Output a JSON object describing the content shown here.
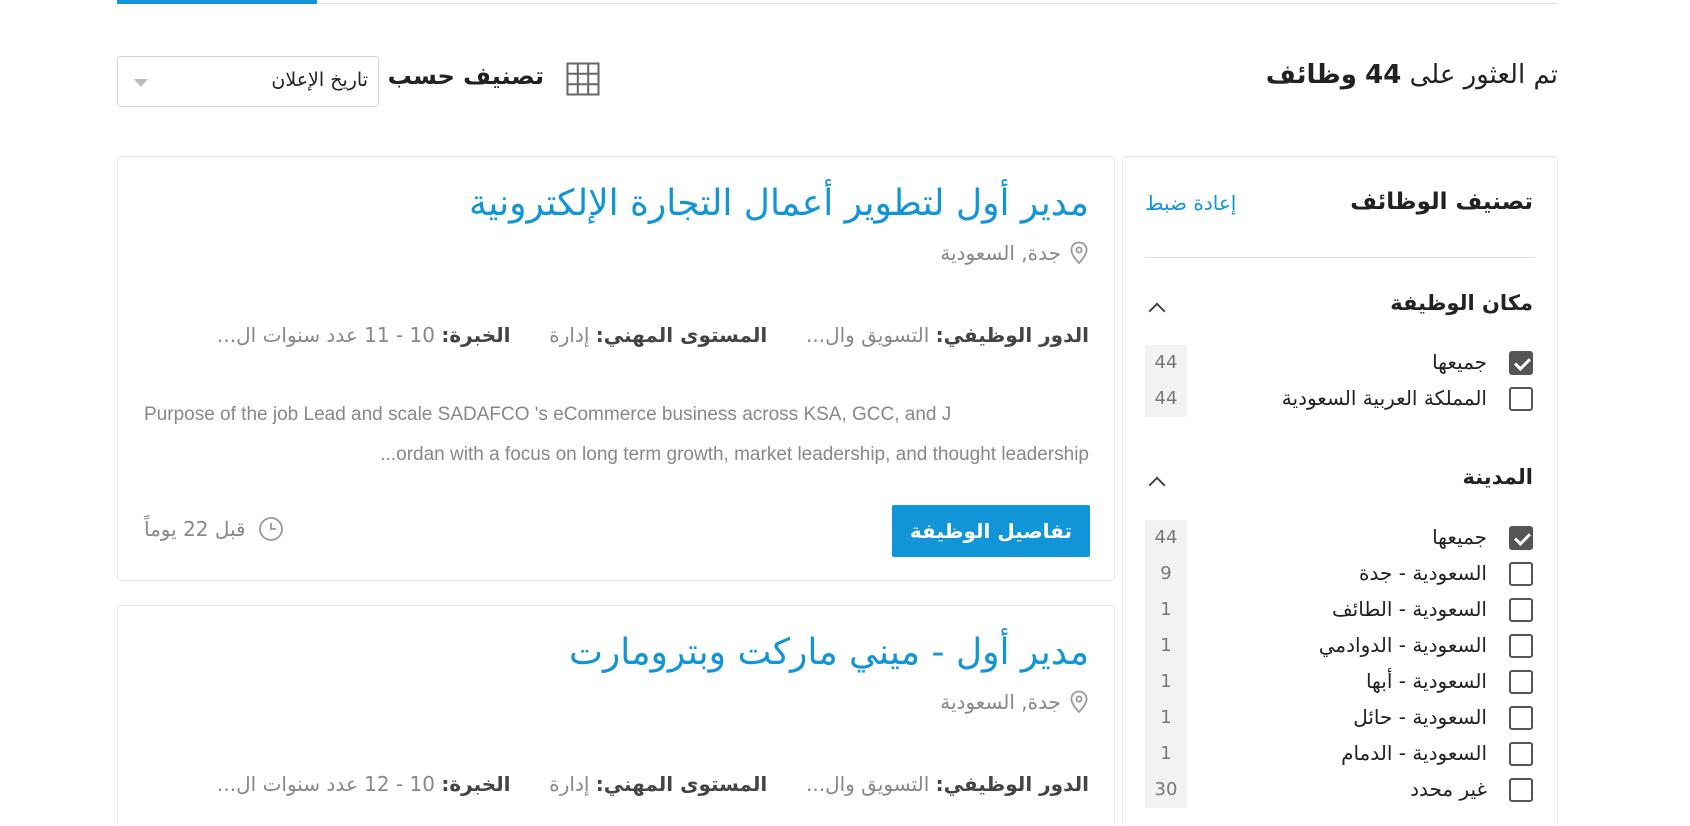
{
  "results": {
    "prefix": "تم العثور على",
    "count": "44",
    "suffix": "وظائف"
  },
  "sort": {
    "label": "تصنيف حسب",
    "selected": "تاريخ الإعلان"
  },
  "colors": {
    "accent": "#1195d8",
    "muted": "#888888"
  },
  "filters": {
    "title": "تصنيف الوظائف",
    "reset_label": "إعادة ضبط",
    "location": {
      "title": "مكان الوظيفة",
      "items": [
        {
          "label": "جميعها",
          "count": "44",
          "checked": true
        },
        {
          "label": "المملكة العربية السعودية",
          "count": "44",
          "checked": false
        }
      ]
    },
    "city": {
      "title": "المدينة",
      "items": [
        {
          "label": "جميعها",
          "count": "44",
          "checked": true
        },
        {
          "label": "السعودية - جدة",
          "count": "9",
          "checked": false
        },
        {
          "label": "السعودية - الطائف",
          "count": "1",
          "checked": false
        },
        {
          "label": "السعودية - الدوادمي",
          "count": "1",
          "checked": false
        },
        {
          "label": "السعودية - أبها",
          "count": "1",
          "checked": false
        },
        {
          "label": "السعودية - حائل",
          "count": "1",
          "checked": false
        },
        {
          "label": "السعودية - الدمام",
          "count": "1",
          "checked": false
        },
        {
          "label": "غير محدد",
          "count": "30",
          "checked": false
        }
      ]
    }
  },
  "jobs": [
    {
      "title": "مدير أول لتطوير أعمال التجارة الإلكترونية",
      "location": "جدة, السعودية",
      "role_key": "الدور الوظيفي:",
      "role_val": "التسويق وال...",
      "level_key": "المستوى المهني:",
      "level_val": "إدارة",
      "exp_key": "الخبرة:",
      "exp_val": "10 - 11 عدد سنوات ال...",
      "desc_line1": "Purpose of the job   Lead and scale SADAFCO 's eCommerce business across KSA, GCC, and J",
      "desc_line2": "ordan with a focus on long term growth, market leadership, and thought leadership...",
      "details_label": "تفاصيل الوظيفة",
      "posted": "قبل 22 يوماً"
    },
    {
      "title": "مدير أول - ميني ماركت وبترومارت",
      "location": "جدة, السعودية",
      "role_key": "الدور الوظيفي:",
      "role_val": "التسويق وال...",
      "level_key": "المستوى المهني:",
      "level_val": "إدارة",
      "exp_key": "الخبرة:",
      "exp_val": "10 - 12 عدد سنوات ال..."
    }
  ]
}
